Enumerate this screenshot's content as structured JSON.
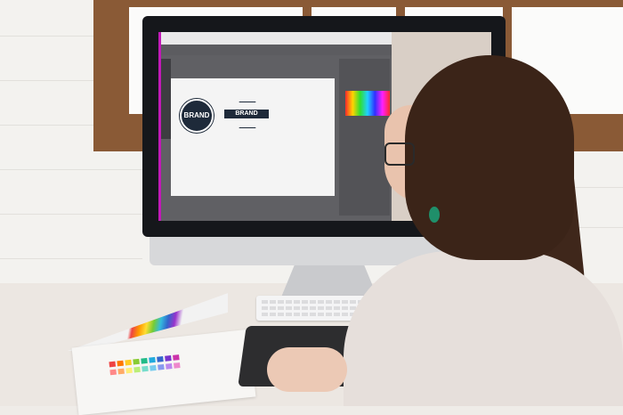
{
  "scene": {
    "screen": {
      "logos": [
        {
          "text": "BRAND"
        },
        {
          "text": "BRAND"
        }
      ]
    }
  }
}
